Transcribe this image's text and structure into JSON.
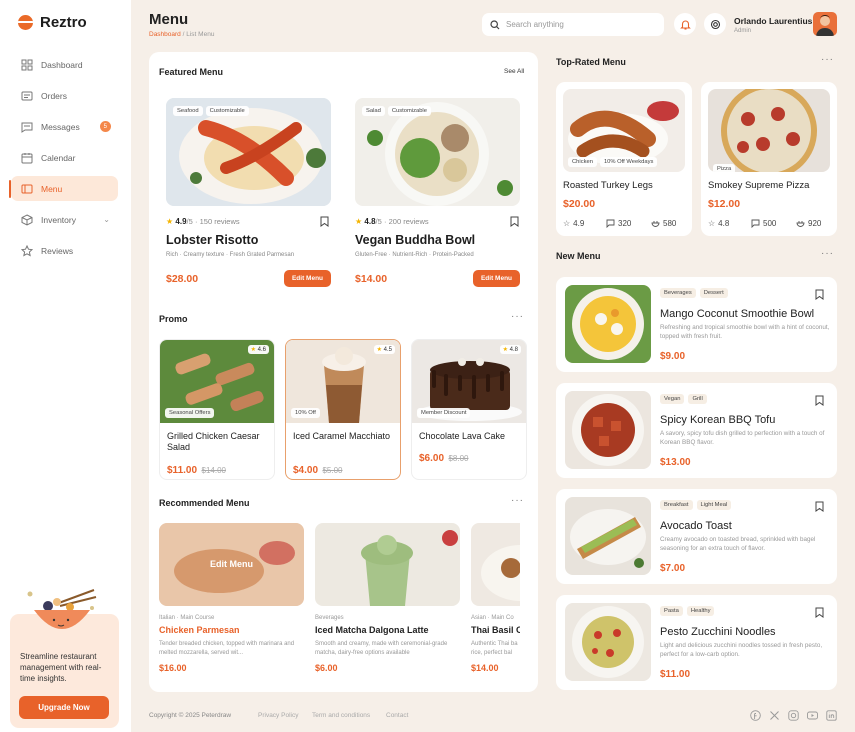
{
  "brand": {
    "name": "Reztro"
  },
  "nav": {
    "items": [
      {
        "label": "Dashboard"
      },
      {
        "label": "Orders"
      },
      {
        "label": "Messages",
        "badge": "5"
      },
      {
        "label": "Calendar"
      },
      {
        "label": "Menu"
      },
      {
        "label": "Inventory"
      },
      {
        "label": "Reviews"
      }
    ]
  },
  "promo_box": {
    "text": "Streamline restaurant management with real-time insights.",
    "button": "Upgrade Now"
  },
  "header": {
    "title": "Menu",
    "breadcrumb": [
      "Dashboard",
      "/",
      "List Menu"
    ],
    "search_placeholder": "Search anything",
    "user_name": "Orlando Laurentius",
    "user_role": "Admin"
  },
  "featured": {
    "title": "Featured Menu",
    "see_all": "See All",
    "items": [
      {
        "tags": [
          "Seafood",
          "Customizable"
        ],
        "rating": "4.9",
        "rating_max": "/5",
        "reviews": "150 reviews",
        "name": "Lobster Risotto",
        "desc": "Rich · Creamy texture · Fresh Grated Parmesan",
        "price": "$28.00",
        "button": "Edit Menu"
      },
      {
        "tags": [
          "Salad",
          "Customizable"
        ],
        "rating": "4.8",
        "rating_max": "/5",
        "reviews": "200 reviews",
        "name": "Vegan Buddha Bowl",
        "desc": "Gluten-Free · Nutrient-Rich · Protein-Packed",
        "price": "$14.00",
        "button": "Edit Menu"
      }
    ]
  },
  "promo": {
    "title": "Promo",
    "items": [
      {
        "tag": "Seasonal Offers",
        "rating": "4.6",
        "name": "Grilled Chicken Caesar Salad",
        "price": "$11.00",
        "old_price": "$14.00"
      },
      {
        "tag": "10% Off",
        "rating": "4.5",
        "name": "Iced Caramel Macchiato",
        "price": "$4.00",
        "old_price": "$5.00"
      },
      {
        "tag": "Member Discount",
        "rating": "4.8",
        "name": "Chocolate Lava Cake",
        "price": "$6.00",
        "old_price": "$8.00"
      }
    ]
  },
  "recommended": {
    "title": "Recommended Menu",
    "hover_label": "Edit Menu",
    "items": [
      {
        "meta": "Italian · Main Course",
        "name": "Chicken Parmesan",
        "desc": "Tender breaded chicken, topped with marinara and melted mozzarella, served wit...",
        "price": "$16.00"
      },
      {
        "meta": "Beverages",
        "name": "Iced Matcha Dalgona Latte",
        "desc": "Smooth and creamy, made with ceremonial-grade matcha, dairy-free options available",
        "price": "$6.00"
      },
      {
        "meta": "Asian · Main Co",
        "name": "Thai Basil Ch",
        "desc": "Authentic Thai ba rice, perfect bal",
        "price": "$14.00"
      }
    ]
  },
  "top_rated": {
    "title": "Top-Rated Menu",
    "items": [
      {
        "tags": [
          "Chicken",
          "10% Off Weekdays"
        ],
        "name": "Roasted Turkey Legs",
        "price": "$20.00",
        "rating": "4.9",
        "reviews": "320",
        "orders": "580"
      },
      {
        "tags": [
          "Pizza"
        ],
        "name": "Smokey Supreme Pizza",
        "price": "$12.00",
        "rating": "4.8",
        "reviews": "500",
        "orders": "920"
      }
    ]
  },
  "new_menu": {
    "title": "New Menu",
    "items": [
      {
        "tags": [
          "Beverages",
          "Dessert"
        ],
        "name": "Mango Coconut Smoothie Bowl",
        "desc": "Refreshing and tropical smoothie bowl with a hint of coconut, topped with fresh fruit.",
        "price": "$9.00"
      },
      {
        "tags": [
          "Vegan",
          "Grill"
        ],
        "name": "Spicy Korean BBQ Tofu",
        "desc": "A savory, spicy tofu dish grilled to perfection with a touch of Korean BBQ flavor.",
        "price": "$13.00"
      },
      {
        "tags": [
          "Breakfast",
          "Light Meal"
        ],
        "name": "Avocado Toast",
        "desc": "Creamy avocado on toasted bread, sprinkled with bagel seasoning for an extra touch of flavor.",
        "price": "$7.00"
      },
      {
        "tags": [
          "Pasta",
          "Healthy"
        ],
        "name": "Pesto Zucchini Noodles",
        "desc": "Light and delicious zucchini noodles tossed in fresh pesto, perfect for a low-carb option.",
        "price": "$11.00"
      }
    ]
  },
  "footer": {
    "copyright": "Copyright © 2025 Peterdraw",
    "links": [
      "Privacy Policy",
      "Term and conditions",
      "Contact"
    ]
  },
  "colors": {
    "accent": "#e8622a",
    "bg": "#f6efe8"
  }
}
